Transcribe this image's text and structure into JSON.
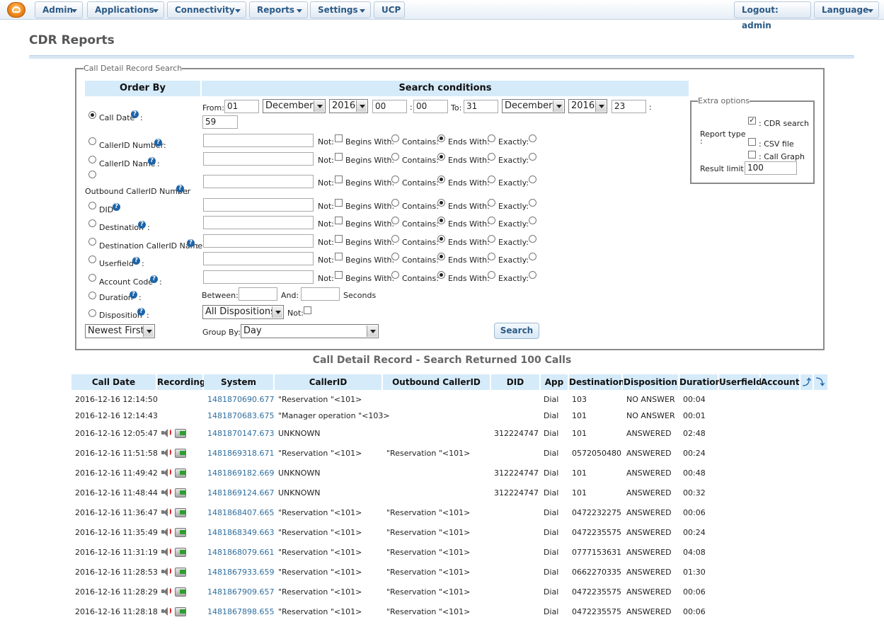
{
  "nav": {
    "admin": "Admin",
    "applications": "Applications",
    "connectivity": "Connectivity",
    "reports": "Reports",
    "settings": "Settings",
    "ucp": "UCP",
    "logout": "Logout: admin",
    "language": "Language"
  },
  "page_title": "CDR Reports",
  "search": {
    "legend": "Call Detail Record Search",
    "order_by_header": "Order By",
    "conditions_header": "Search conditions",
    "from_label": "From:",
    "to_label": "To:",
    "from": {
      "day": "01",
      "month": "December",
      "year": "2016",
      "hour": "00",
      "minute": "00"
    },
    "to": {
      "day": "31",
      "month": "December",
      "year": "2016",
      "hour": "23",
      "minute": "59"
    },
    "colon": ":",
    "not_label": "Not:",
    "begins_label": "Begins With:",
    "contains_label": "Contains:",
    "ends_label": "Ends With:",
    "exactly_label": "Exactly:",
    "fields": [
      "Call Date",
      "CallerID Number",
      "CallerID Name",
      "Outbound CallerID Number",
      "DID",
      "Destination",
      "Destination CallerID Name",
      "Userfield",
      "Account Code",
      "Duration",
      "Disposition"
    ],
    "between_label": "Between:",
    "and_label": "And:",
    "seconds_label": "Seconds",
    "disposition_value": "All Dispositions",
    "order_value": "Newest First",
    "group_by_label": "Group By:",
    "group_by_value": "Day",
    "search_button": "Search"
  },
  "extra": {
    "legend": "Extra options",
    "report_type_label": "Report type",
    "report_type_colon": ":",
    "cdr_search": ": CDR search",
    "csv_file": ": CSV file",
    "call_graph": ": Call Graph",
    "result_limit_label": "Result limit :",
    "result_limit": "100"
  },
  "results": {
    "title": "Call Detail Record - Search Returned 100 Calls",
    "headers": [
      "Call Date",
      "Recording",
      "System",
      "CallerID",
      "Outbound CallerID",
      "DID",
      "App",
      "Destination",
      "Disposition",
      "Duration",
      "Userfield",
      "Account"
    ],
    "rows": [
      {
        "date": "2016-12-16 12:14:50",
        "rec": false,
        "system": "1481870690.677",
        "callerid": "\"Reservation \"<101>",
        "outbound": "",
        "did": "",
        "app": "Dial",
        "dest": "103",
        "disp": "NO ANSWER",
        "dur": "00:04"
      },
      {
        "date": "2016-12-16 12:14:43",
        "rec": false,
        "system": "1481870683.675",
        "callerid": "\"Manager operation \"<103>",
        "outbound": "",
        "did": "",
        "app": "Dial",
        "dest": "101",
        "disp": "NO ANSWER",
        "dur": "00:01"
      },
      {
        "date": "2016-12-16 12:05:47",
        "rec": true,
        "system": "1481870147.673",
        "callerid": "UNKNOWN",
        "outbound": "",
        "did": "312224747",
        "app": "Dial",
        "dest": "101",
        "disp": "ANSWERED",
        "dur": "02:48"
      },
      {
        "date": "2016-12-16 11:51:58",
        "rec": true,
        "system": "1481869318.671",
        "callerid": "\"Reservation \"<101>",
        "outbound": "\"Reservation \"<101>",
        "did": "",
        "app": "Dial",
        "dest": "0572050480",
        "disp": "ANSWERED",
        "dur": "00:24"
      },
      {
        "date": "2016-12-16 11:49:42",
        "rec": true,
        "system": "1481869182.669",
        "callerid": "UNKNOWN",
        "outbound": "",
        "did": "312224747",
        "app": "Dial",
        "dest": "101",
        "disp": "ANSWERED",
        "dur": "00:48"
      },
      {
        "date": "2016-12-16 11:48:44",
        "rec": true,
        "system": "1481869124.667",
        "callerid": "UNKNOWN",
        "outbound": "",
        "did": "312224747",
        "app": "Dial",
        "dest": "101",
        "disp": "ANSWERED",
        "dur": "00:32"
      },
      {
        "date": "2016-12-16 11:36:47",
        "rec": true,
        "system": "1481868407.665",
        "callerid": "\"Reservation \"<101>",
        "outbound": "\"Reservation \"<101>",
        "did": "",
        "app": "Dial",
        "dest": "0472232275",
        "disp": "ANSWERED",
        "dur": "00:06"
      },
      {
        "date": "2016-12-16 11:35:49",
        "rec": true,
        "system": "1481868349.663",
        "callerid": "\"Reservation \"<101>",
        "outbound": "\"Reservation \"<101>",
        "did": "",
        "app": "Dial",
        "dest": "0472235575",
        "disp": "ANSWERED",
        "dur": "00:24"
      },
      {
        "date": "2016-12-16 11:31:19",
        "rec": true,
        "system": "1481868079.661",
        "callerid": "\"Reservation \"<101>",
        "outbound": "\"Reservation \"<101>",
        "did": "",
        "app": "Dial",
        "dest": "0777153631",
        "disp": "ANSWERED",
        "dur": "04:08"
      },
      {
        "date": "2016-12-16 11:28:53",
        "rec": true,
        "system": "1481867933.659",
        "callerid": "\"Reservation \"<101>",
        "outbound": "\"Reservation \"<101>",
        "did": "",
        "app": "Dial",
        "dest": "0662270335",
        "disp": "ANSWERED",
        "dur": "01:30"
      },
      {
        "date": "2016-12-16 11:28:29",
        "rec": true,
        "system": "1481867909.657",
        "callerid": "\"Reservation \"<101>",
        "outbound": "\"Reservation \"<101>",
        "did": "",
        "app": "Dial",
        "dest": "0472235575",
        "disp": "ANSWERED",
        "dur": "00:06"
      },
      {
        "date": "2016-12-16 11:28:18",
        "rec": true,
        "system": "1481867898.655",
        "callerid": "\"Reservation \"<101>",
        "outbound": "\"Reservation \"<101>",
        "did": "",
        "app": "Dial",
        "dest": "0472235575",
        "disp": "ANSWERED",
        "dur": "00:06"
      }
    ]
  }
}
